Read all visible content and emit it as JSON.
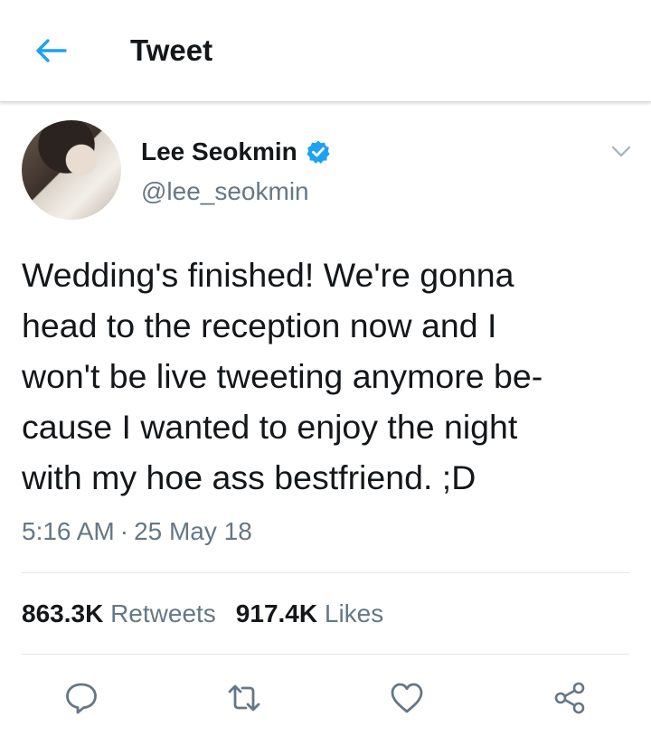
{
  "header": {
    "title": "Tweet"
  },
  "tweet": {
    "author_name": "Lee Seokmin",
    "author_handle": "@lee_seokmin",
    "text_lines": [
      "Wedding's finished! We're gonna",
      "head to the reception now and I",
      "won't be live tweeting anymore be-",
      "cause I wanted to enjoy the night",
      "with my hoe ass bestfriend. ;D"
    ],
    "time": "5:16 AM",
    "separator": "·",
    "date": "25 May 18",
    "retweets_count": "863.3K",
    "retweets_label": "Retweets",
    "likes_count": "917.4K",
    "likes_label": "Likes"
  },
  "icons": {
    "back": "arrow-left-icon",
    "verified": "verified-badge-icon",
    "menu": "chevron-down-icon",
    "reply": "reply-icon",
    "retweet": "retweet-icon",
    "like": "heart-icon",
    "share": "share-icon"
  },
  "colors": {
    "accent": "#1da1f2",
    "secondary_text": "#657786",
    "icon_gray": "#657786"
  }
}
